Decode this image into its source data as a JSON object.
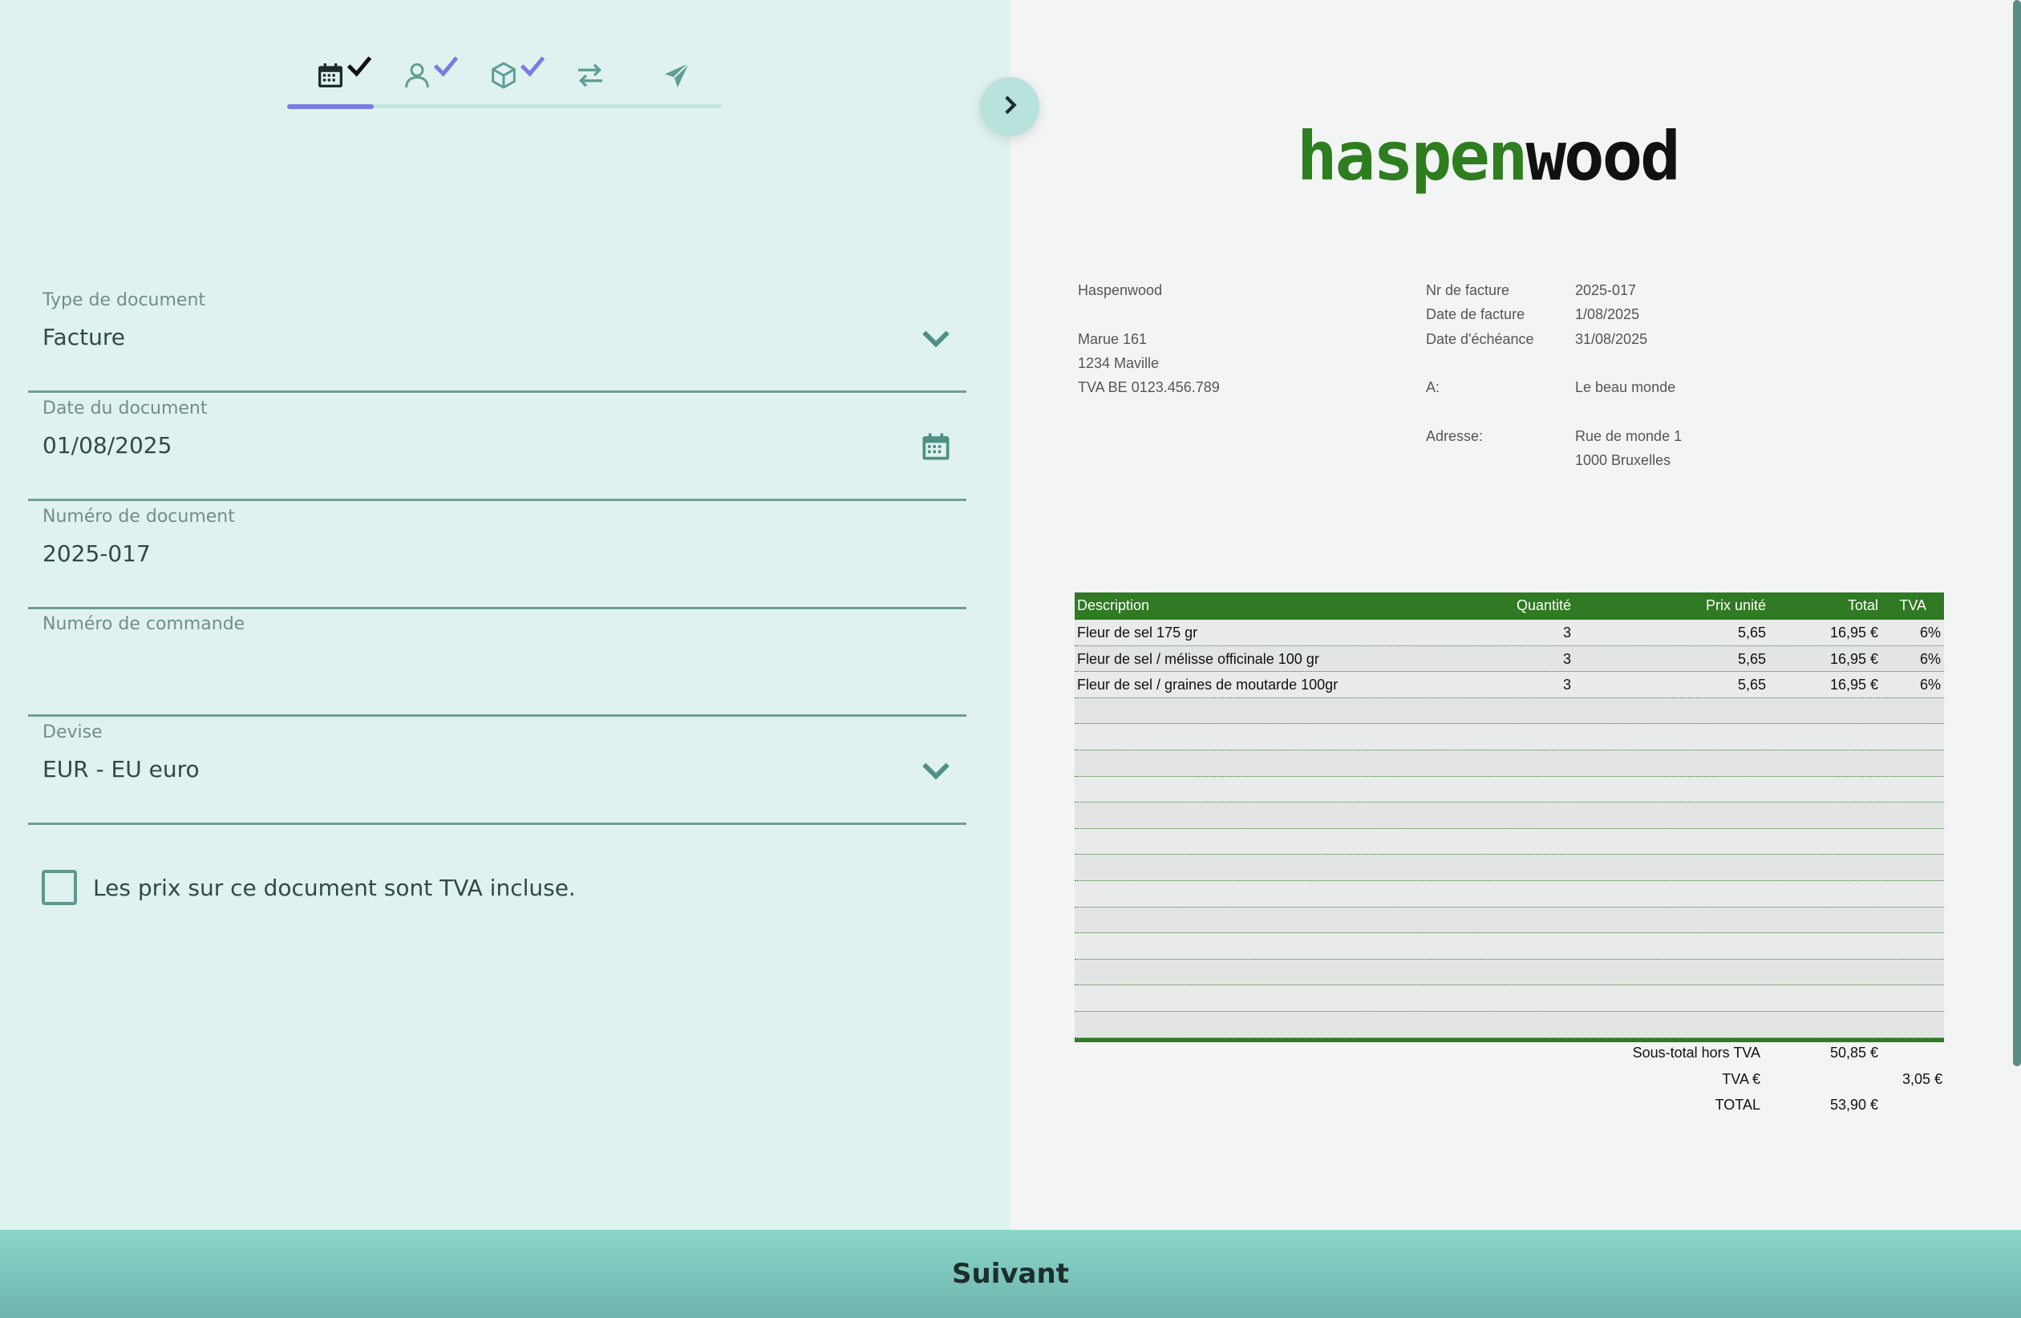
{
  "steps": [
    {
      "name": "calendar-icon",
      "completed": true,
      "active": true
    },
    {
      "name": "user-icon",
      "completed": true,
      "active": false
    },
    {
      "name": "box-icon",
      "completed": true,
      "active": false
    },
    {
      "name": "exchange-icon",
      "completed": false,
      "active": false
    },
    {
      "name": "send-icon",
      "completed": false,
      "active": false
    }
  ],
  "form": {
    "type_label": "Type de document",
    "type_value": "Facture",
    "date_label": "Date du document",
    "date_value": "01/08/2025",
    "number_label": "Numéro de document",
    "number_value": "2025-017",
    "order_label": "Numéro de commande",
    "order_value": "",
    "currency_label": "Devise",
    "currency_value": "EUR - EU euro",
    "vat_included_label": "Les prix sur ce document sont TVA incluse.",
    "vat_included_checked": false
  },
  "invoice": {
    "logo_part1": "haspen",
    "logo_part2": "wood",
    "company": {
      "name": "Haspenwood",
      "street": "Marue 161",
      "city": "1234 Maville",
      "vat": "TVA BE 0123.456.789"
    },
    "meta": {
      "number_label": "Nr de facture",
      "number_value": "2025-017",
      "date_label": "Date de facture",
      "date_value": "1/08/2025",
      "due_label": "Date d'échéance",
      "due_value": "31/08/2025",
      "to_label": "A:",
      "to_value": "Le beau monde",
      "address_label": "Adresse:",
      "address_line1": "Rue de monde 1",
      "address_line2": "1000 Bruxelles"
    },
    "columns": {
      "description": "Description",
      "quantity": "Quantité",
      "unit_price": "Prix unité",
      "total": "Total",
      "vat": "TVA"
    },
    "lines": [
      {
        "description": "Fleur de sel 175 gr",
        "quantity": "3",
        "unit_price": "5,65",
        "total": "16,95 €",
        "vat": "6%"
      },
      {
        "description": "Fleur de sel / mélisse officinale 100 gr",
        "quantity": "3",
        "unit_price": "5,65",
        "total": "16,95 €",
        "vat": "6%"
      },
      {
        "description": "Fleur de sel / graines de moutarde 100gr",
        "quantity": "3",
        "unit_price": "5,65",
        "total": "16,95 €",
        "vat": "6%"
      }
    ],
    "empty_rows": 13,
    "totals": {
      "subtotal_label": "Sous-total hors TVA",
      "subtotal_value": "50,85 €",
      "vat_label": "TVA €",
      "vat_value": "3,05 €",
      "total_label": "TOTAL",
      "total_value": "53,90 €"
    }
  },
  "footer": {
    "next_label": "Suivant"
  },
  "colors": {
    "accent": "#7b7be0",
    "invoice_green": "#2f7a23",
    "panel_bg": "#e0f2ef",
    "footer_bg": "#8ad6c9"
  }
}
